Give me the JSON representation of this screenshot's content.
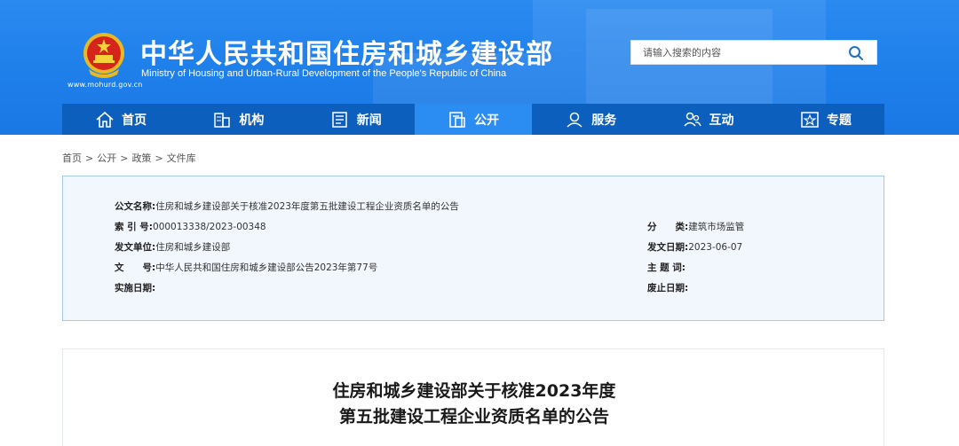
{
  "header": {
    "title_cn": "中华人民共和国住房和城乡建设部",
    "title_en": "Ministry of Housing and Urban-Rural Development of the People's Republic of China",
    "site_url": "www.mohurd.gov.cn",
    "emblem_icon": "national-emblem-icon",
    "bg_color": "#1f7fea"
  },
  "search": {
    "placeholder": "请输入搜索的内容",
    "icon": "search-icon"
  },
  "nav": {
    "items": [
      {
        "label": "首页",
        "icon": "home-icon"
      },
      {
        "label": "机构",
        "icon": "building-icon"
      },
      {
        "label": "新闻",
        "icon": "news-icon"
      },
      {
        "label": "公开",
        "icon": "document-icon",
        "active": true
      },
      {
        "label": "服务",
        "icon": "person-icon"
      },
      {
        "label": "互动",
        "icon": "people-icon"
      },
      {
        "label": "专题",
        "icon": "star-box-icon"
      }
    ],
    "bg_color": "#0d5fbd",
    "active_color": "#2b8cf2"
  },
  "breadcrumb": [
    "首页",
    "公开",
    "政策",
    "文件库"
  ],
  "breadcrumb_sep": ">",
  "info": {
    "name_label": "公文名称:",
    "name_value": "住房和城乡建设部关于核准2023年度第五批建设工程企业资质名单的公告",
    "index_label": "索 引 号:",
    "index_value": "000013338/2023-00348",
    "category_label": "分　　类:",
    "category_value": "建筑市场监管",
    "issuer_label": "发文单位:",
    "issuer_value": "住房和城乡建设部",
    "date_label": "发文日期:",
    "date_value": "2023-06-07",
    "doc_no_label": "文　　号:",
    "doc_no_value": "中华人民共和国住房和城乡建设部公告2023年第77号",
    "keyword_label": "主 题 词:",
    "keyword_value": "",
    "effective_label": "实施日期:",
    "effective_value": "",
    "repeal_label": "废止日期:",
    "repeal_value": ""
  },
  "article": {
    "title_line1": "住房和城乡建设部关于核准2023年度",
    "title_line2": "第五批建设工程企业资质名单的公告"
  }
}
